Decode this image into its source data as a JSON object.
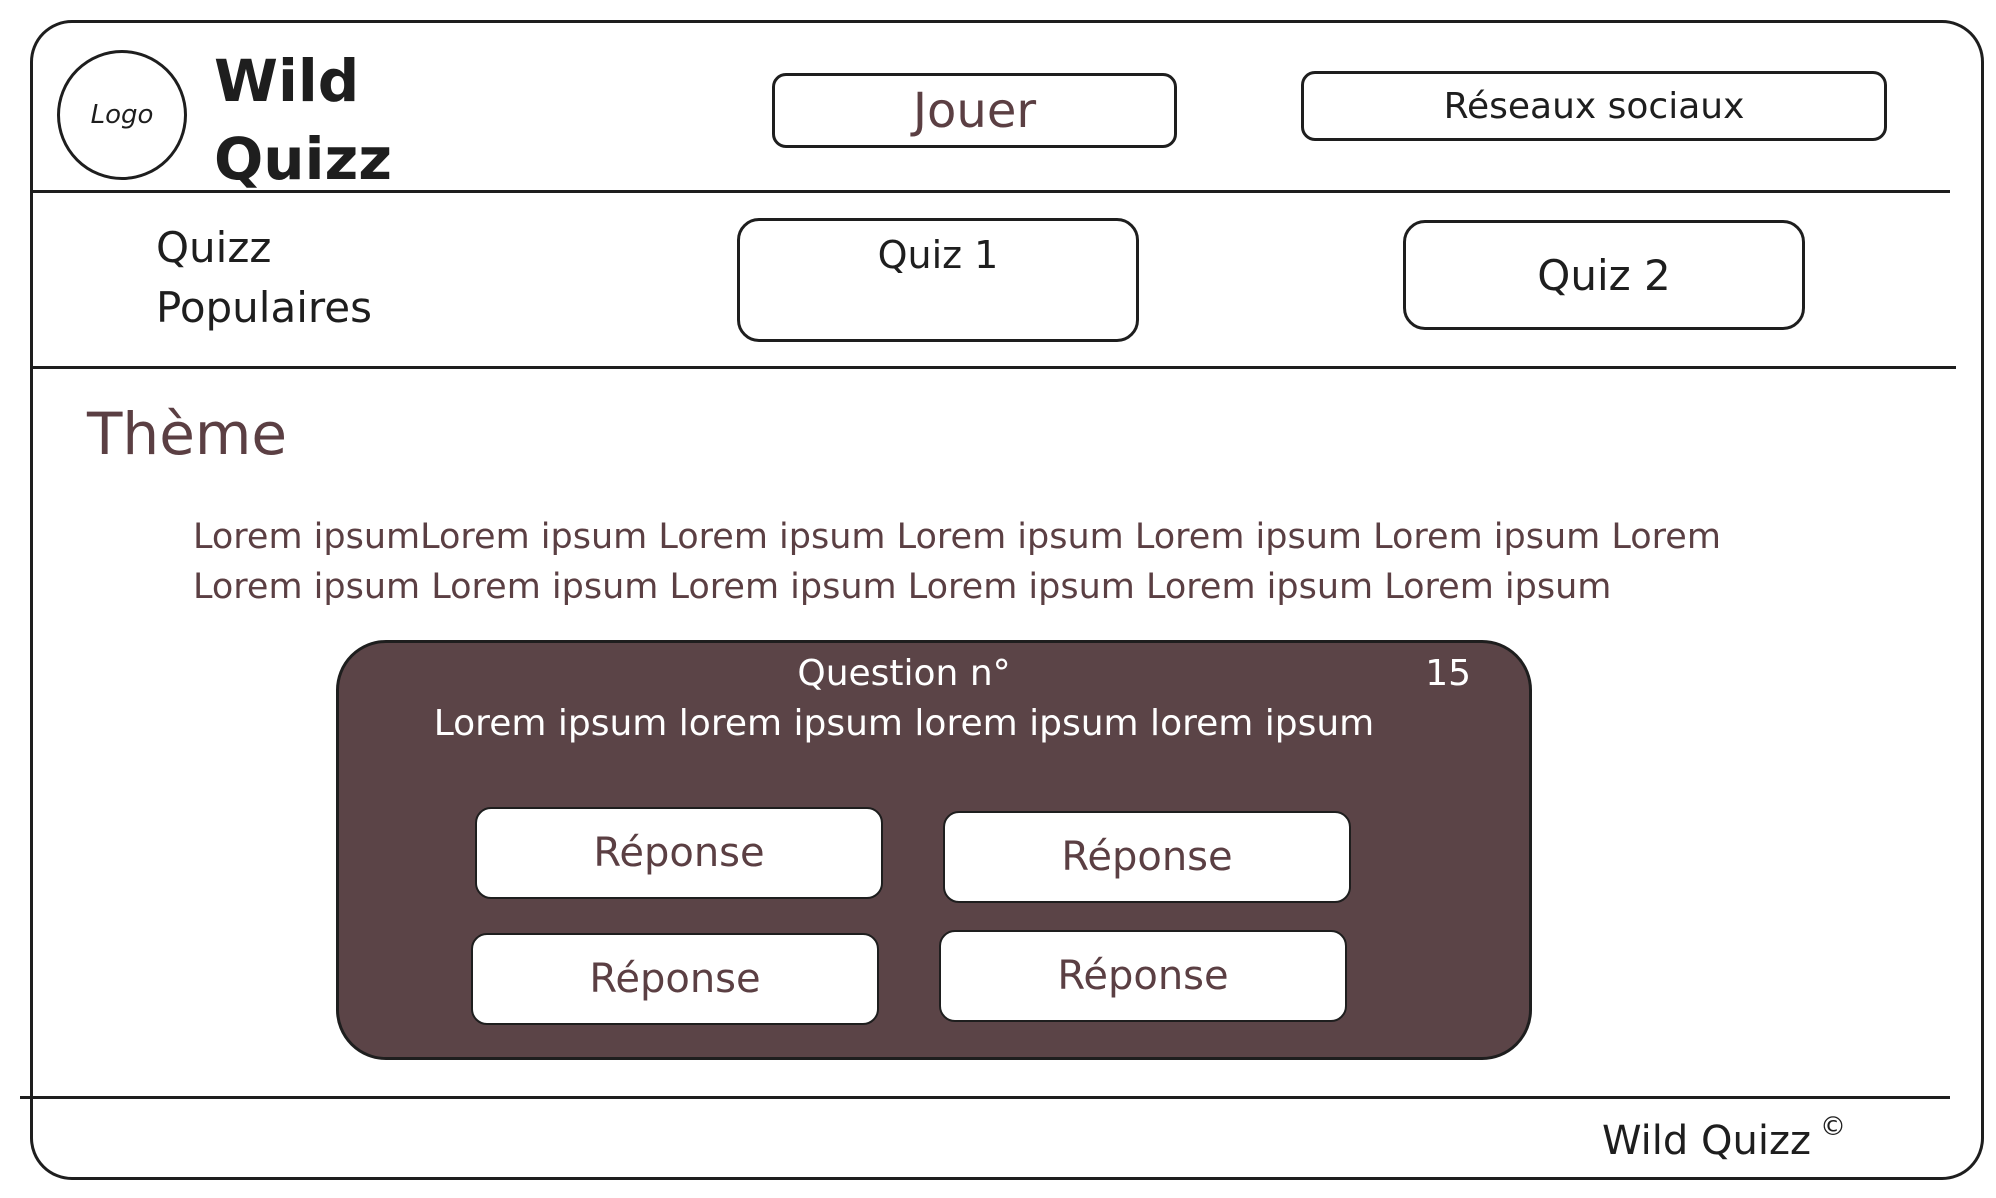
{
  "header": {
    "logo_label": "Logo",
    "brand_title": "Wild\nQuizz",
    "play_button": "Jouer",
    "social_button": "Réseaux sociaux"
  },
  "popular": {
    "title": "Quizz\nPopulaires",
    "quizzes": [
      {
        "label": "Quiz 1"
      },
      {
        "label": "Quiz 2"
      }
    ]
  },
  "main": {
    "theme_title": "Thème",
    "description_line1": "Lorem ipsumLorem ipsum Lorem ipsum Lorem ipsum Lorem ipsum Lorem ipsum Lorem",
    "description_line2": "Lorem ipsum Lorem ipsum Lorem ipsum Lorem ipsum Lorem ipsum Lorem ipsum"
  },
  "question": {
    "title": "Question n°",
    "timer": "15",
    "text": "Lorem ipsum lorem ipsum lorem ipsum lorem ipsum",
    "answers": [
      {
        "label": "Réponse"
      },
      {
        "label": "Réponse"
      },
      {
        "label": "Réponse"
      },
      {
        "label": "Réponse"
      }
    ]
  },
  "footer": {
    "brand": "Wild Quizz",
    "copyright_symbol": "©"
  },
  "colors": {
    "accent": "#5b3f43",
    "panel": "#5b4447",
    "stroke": "#1e1e1e"
  }
}
